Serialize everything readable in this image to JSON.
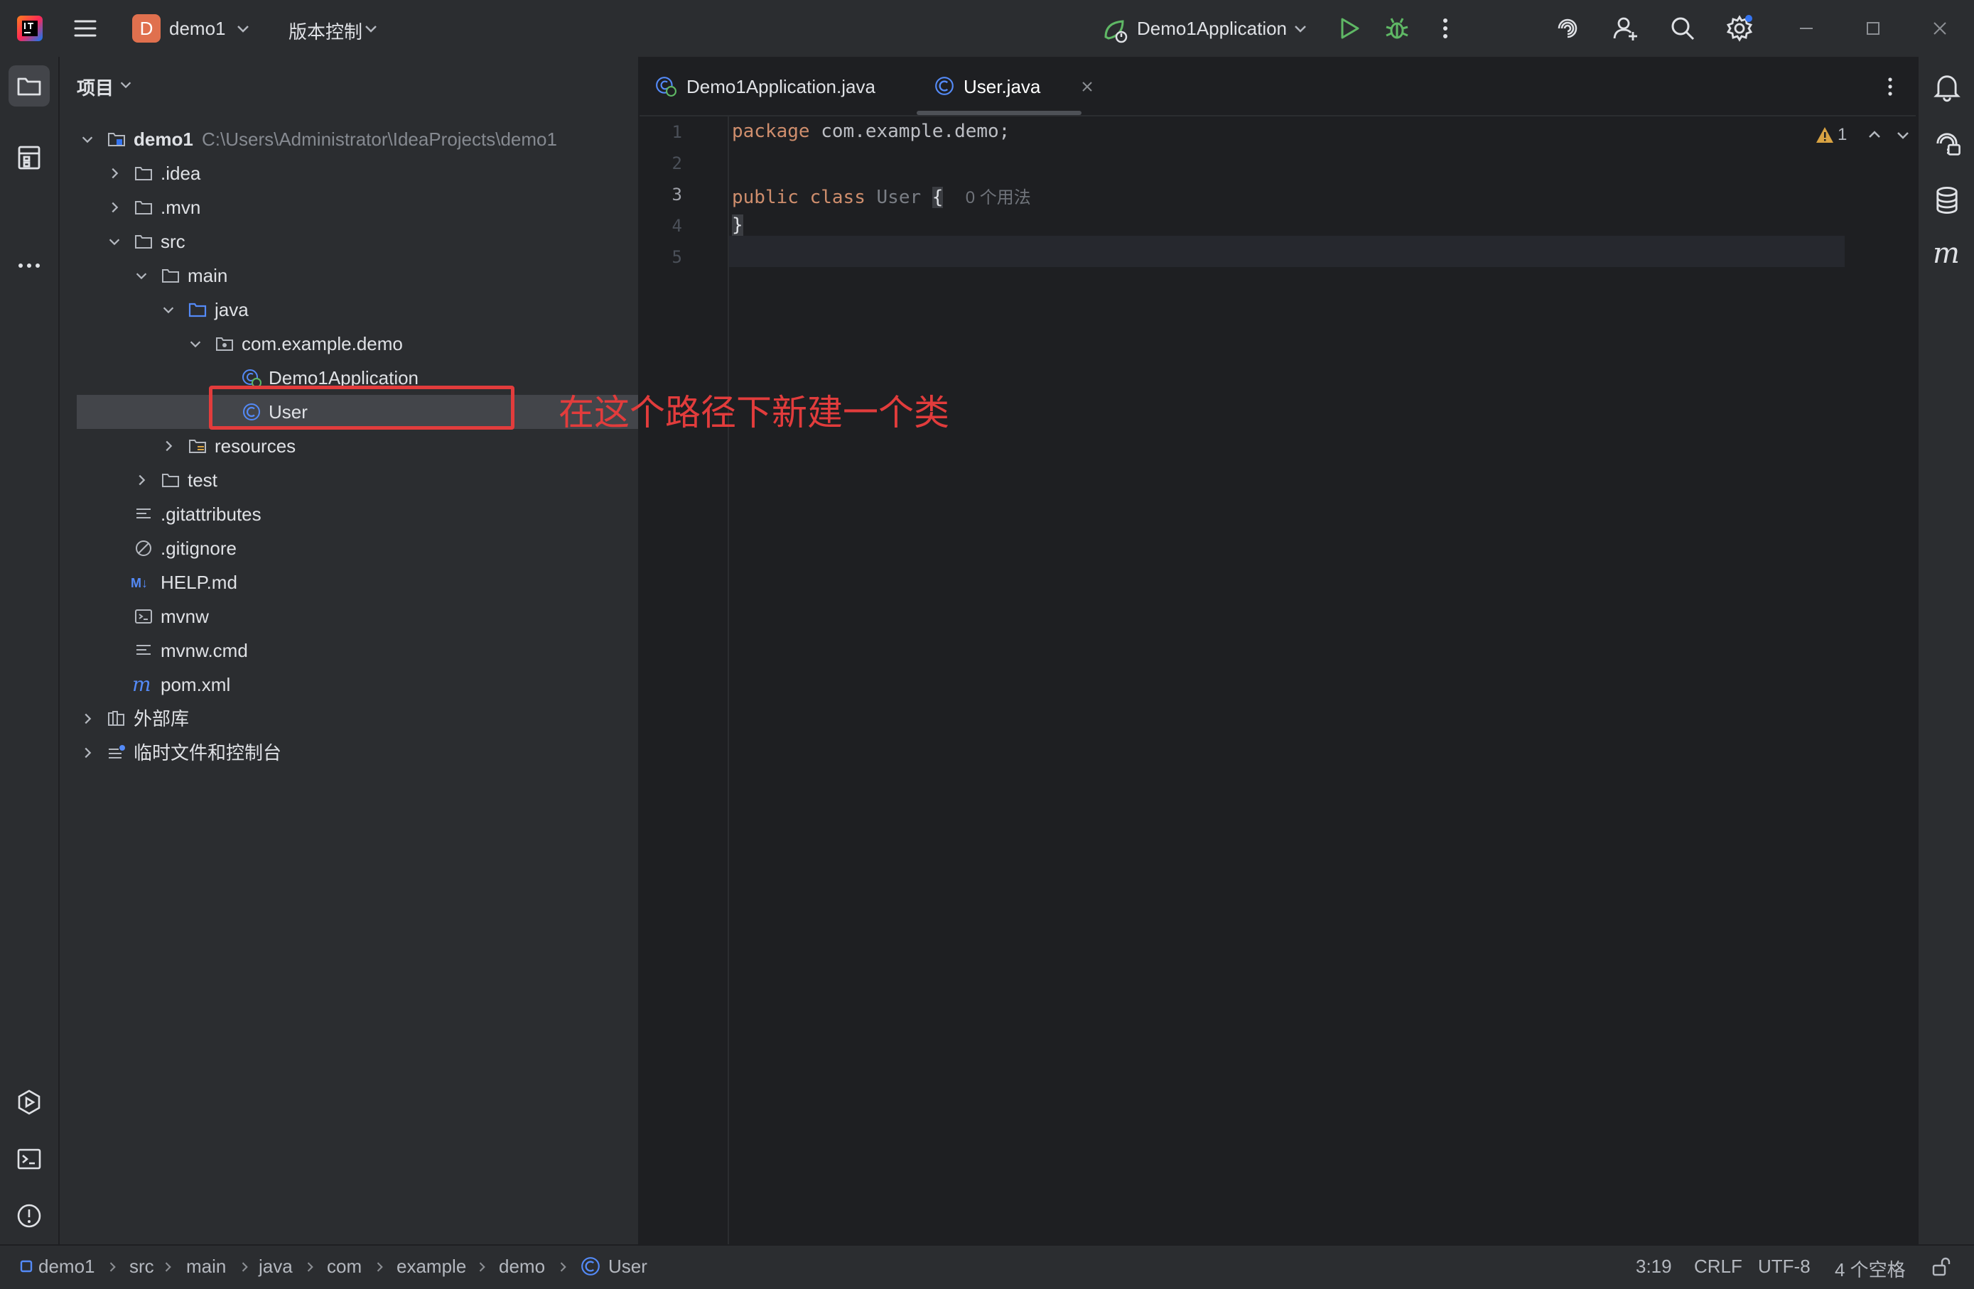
{
  "titlebar": {
    "project_badge": "D",
    "project_name": "demo1",
    "vcs_label": "版本控制",
    "run_config": "Demo1Application"
  },
  "project_panel": {
    "title": "项目",
    "root_name": "demo1",
    "root_path": "C:\\Users\\Administrator\\IdeaProjects\\demo1",
    "items": [
      {
        "label": ".idea"
      },
      {
        "label": ".mvn"
      },
      {
        "label": "src"
      },
      {
        "label": "main"
      },
      {
        "label": "java"
      },
      {
        "label": "com.example.demo"
      },
      {
        "label": "Demo1Application"
      },
      {
        "label": "User"
      },
      {
        "label": "resources"
      },
      {
        "label": "test"
      },
      {
        "label": ".gitattributes"
      },
      {
        "label": ".gitignore"
      },
      {
        "label": "HELP.md"
      },
      {
        "label": "mvnw"
      },
      {
        "label": "mvnw.cmd"
      },
      {
        "label": "pom.xml"
      },
      {
        "label": "外部库"
      },
      {
        "label": "临时文件和控制台"
      }
    ]
  },
  "tabs": [
    {
      "label": "Demo1Application.java"
    },
    {
      "label": "User.java"
    }
  ],
  "editor": {
    "line_numbers": [
      "1",
      "2",
      "3",
      "4",
      "5"
    ],
    "line1_kw": "package",
    "line1_rest": " com.example.demo;",
    "line3_kw1": "public",
    "line3_kw2": "class",
    "line3_name": "User",
    "line3_brace": "{",
    "line3_hint": "0 个用法",
    "line4_text": "}",
    "warning_count": "1"
  },
  "annotation": {
    "text": "在这个路径下新建一个类"
  },
  "statusbar": {
    "breadcrumbs": [
      "demo1",
      "src",
      "main",
      "java",
      "com",
      "example",
      "demo",
      "User"
    ],
    "position": "3:19",
    "line_sep": "CRLF",
    "encoding": "UTF-8",
    "indent": "4 个空格"
  },
  "colors": {
    "accent": "#3574f0",
    "annotation": "#e23c3c",
    "keyword": "#cf8e6d",
    "run_green": "#5fb865"
  }
}
